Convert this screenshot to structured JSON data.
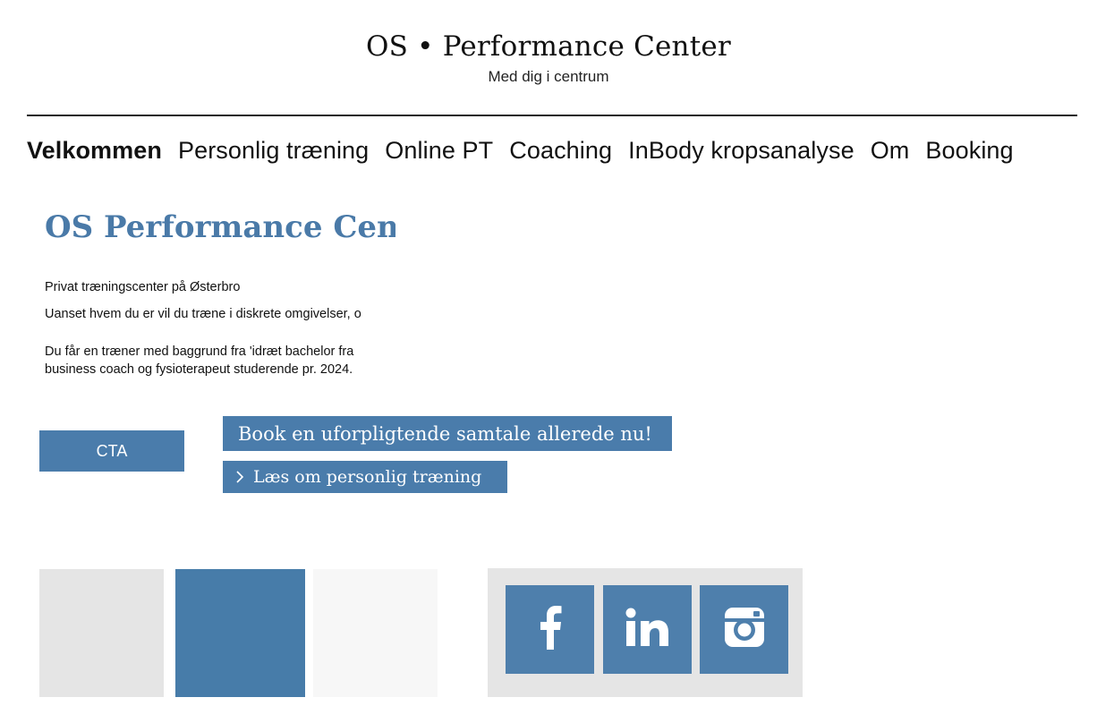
{
  "header": {
    "site_title": "OS • Performance Center",
    "tagline": "Med dig i centrum"
  },
  "nav": {
    "items": [
      {
        "label": "Velkommen",
        "active": true
      },
      {
        "label": "Personlig træning",
        "active": false
      },
      {
        "label": "Online PT",
        "active": false
      },
      {
        "label": "Coaching",
        "active": false
      },
      {
        "label": "InBody kropsanalyse",
        "active": false
      },
      {
        "label": "Om",
        "active": false
      },
      {
        "label": "Booking",
        "active": false
      }
    ]
  },
  "intro": {
    "title": "OS Performance Center",
    "p1": "Privat træningscenter på Østerbro",
    "p2": "Uanset hvem du er vil du træne i diskrete omgivelser, o",
    "p3_line1": "Du får en træner med baggrund fra 'idræt bachelor fra",
    "p3_line2": "business coach og fysioterapeut studerende pr. 2024."
  },
  "buttons": {
    "cta_label": "CTA",
    "book_label": "Book en uforpligtende samtale allerede nu!",
    "pt_link_label": "Læs om personlig træning"
  },
  "social": {
    "items": [
      {
        "name": "facebook-icon"
      },
      {
        "name": "linkedin-icon"
      },
      {
        "name": "instagram-icon"
      }
    ]
  },
  "colors": {
    "accent": "#4a7cab",
    "title_blue": "#4a7aa8",
    "tile_light": "#e5e5e5",
    "tile_lighter": "#f7f7f7"
  }
}
